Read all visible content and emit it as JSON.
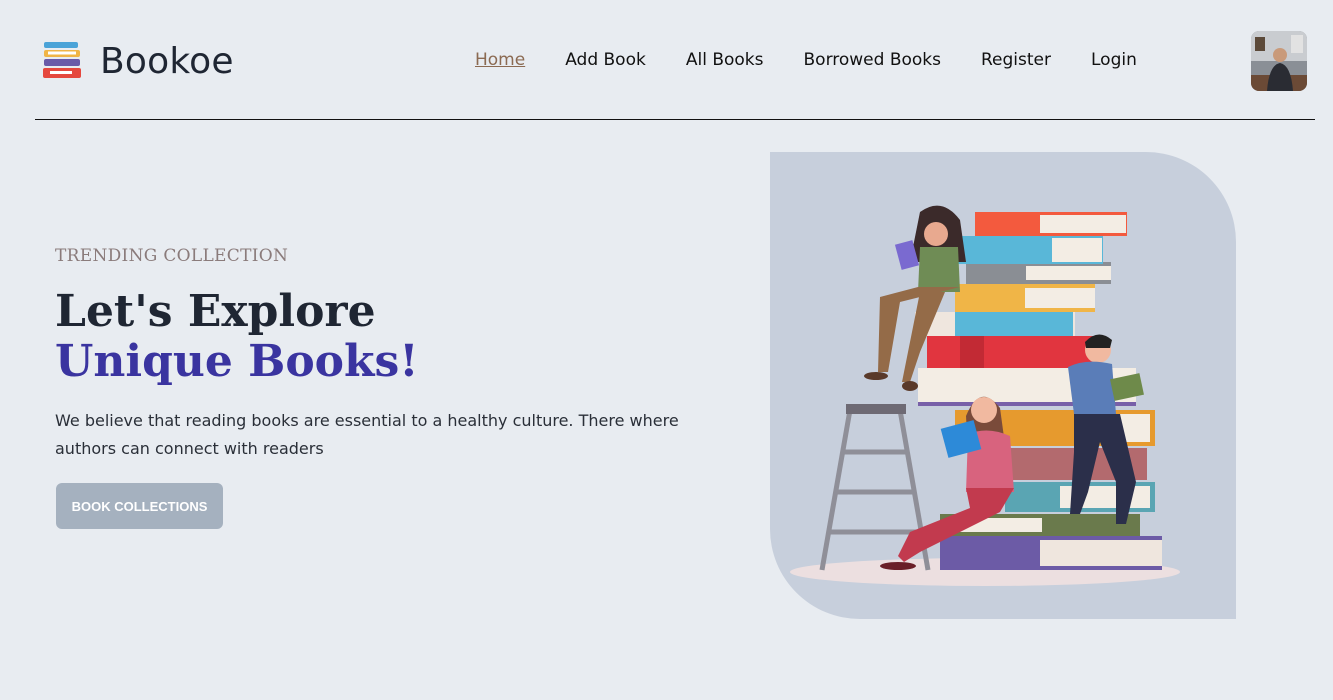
{
  "brand": {
    "name": "Bookoe",
    "logo_icon": "book-stack-icon"
  },
  "nav": {
    "items": [
      {
        "label": "Home",
        "active": true
      },
      {
        "label": "Add Book",
        "active": false
      },
      {
        "label": "All Books",
        "active": false
      },
      {
        "label": "Borrowed Books",
        "active": false
      },
      {
        "label": "Register",
        "active": false
      },
      {
        "label": "Login",
        "active": false
      }
    ]
  },
  "hero": {
    "eyebrow": "TRENDING COLLECTION",
    "title_line1": "Let's Explore",
    "title_line2": "Unique Books!",
    "description": "We believe that reading books are essential to a healthy culture. There where authors can connect with readers",
    "cta_label": "BOOK COLLECTIONS",
    "illustration": "people-reading-on-book-stack-illustration"
  },
  "colors": {
    "background": "#e8ecf1",
    "accent": "#3a34a0",
    "nav_active": "#8b6a52",
    "cta_bg": "#a5b1bf",
    "card_bg": "#c7cfdc"
  }
}
